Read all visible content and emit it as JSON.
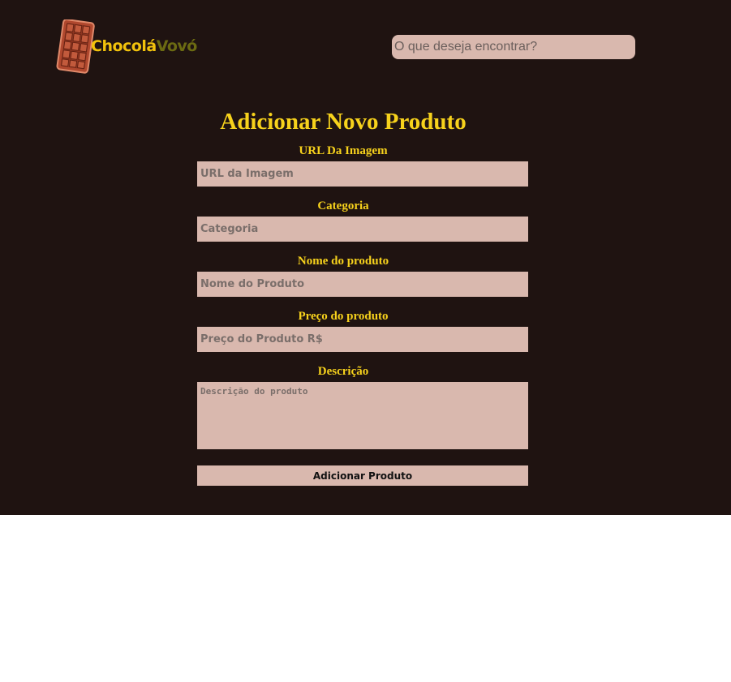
{
  "header": {
    "logo": {
      "text_part1": "Chocolá",
      "text_part2": "Vovó",
      "icon": "chocolate-bar-icon"
    },
    "search": {
      "placeholder": "O que deseja encontrar?",
      "value": ""
    }
  },
  "form": {
    "title": "Adicionar Novo Produto",
    "fields": {
      "image_url": {
        "label": "URL Da Imagem",
        "placeholder": "URL da Imagem",
        "value": ""
      },
      "category": {
        "label": "Categoria",
        "placeholder": "Categoria",
        "value": ""
      },
      "name": {
        "label": "Nome do produto",
        "placeholder": "Nome do Produto",
        "value": ""
      },
      "price": {
        "label": "Preço do produto",
        "placeholder": "Preço do Produto R$",
        "value": ""
      },
      "description": {
        "label": "Descrição",
        "placeholder": "Descrição do produto",
        "value": ""
      }
    },
    "submit_label": "Adicionar Produto"
  },
  "colors": {
    "background": "#1f1311",
    "accent_yellow": "#f7d21c",
    "input_bg": "#d9b8ae",
    "logo_green": "#6b6a12"
  }
}
